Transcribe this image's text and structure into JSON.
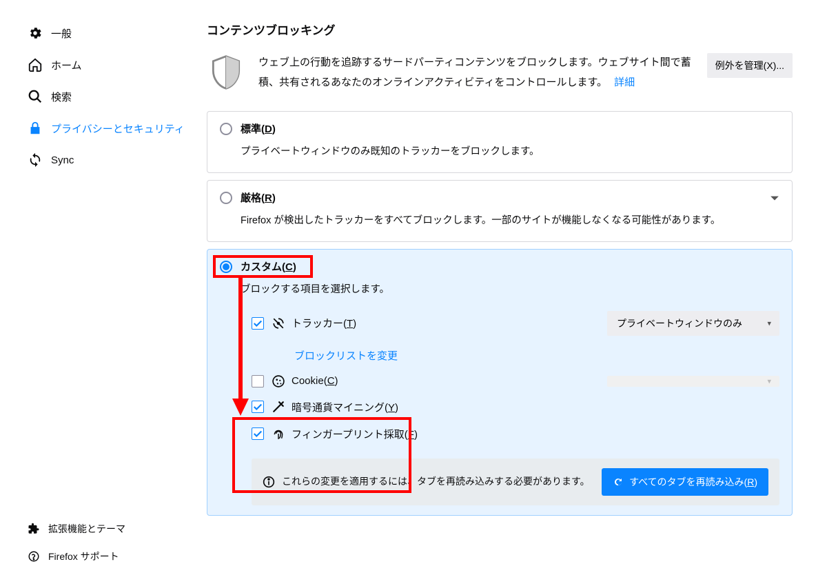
{
  "sidebar": {
    "items": [
      {
        "label": "一般"
      },
      {
        "label": "ホーム"
      },
      {
        "label": "検索"
      },
      {
        "label": "プライバシーとセキュリティ"
      },
      {
        "label": "Sync"
      }
    ],
    "bottom": [
      {
        "label": "拡張機能とテーマ"
      },
      {
        "label": "Firefox サポート"
      }
    ]
  },
  "section": {
    "title": "コンテンツブロッキング",
    "intro": "ウェブ上の行動を追跡するサードパーティコンテンツをブロックします。ウェブサイト間で蓄積、共有されるあなたのオンラインアクティビティをコントロールします。",
    "learn_more": "詳細",
    "exceptions_btn": "例外を管理(X)..."
  },
  "modes": {
    "standard": {
      "title_pre": "標準(",
      "hotkey": "D",
      "title_post": ")",
      "desc": "プライベートウィンドウのみ既知のトラッカーをブロックします。"
    },
    "strict": {
      "title_pre": "厳格(",
      "hotkey": "R",
      "title_post": ")",
      "desc": "Firefox が検出したトラッカーをすべてブロックします。一部のサイトが機能しなくなる可能性があります。"
    },
    "custom": {
      "title_pre": "カスタム(",
      "hotkey": "C",
      "title_post": ")",
      "desc": "ブロックする項目を選択します。"
    }
  },
  "options": {
    "trackers": {
      "label_pre": "トラッカー(",
      "hotkey": "T",
      "label_post": ")",
      "checked": true,
      "select": "プライベートウィンドウのみ"
    },
    "blocklist_link": "ブロックリストを変更",
    "cookies": {
      "label_pre": "Cookie(",
      "hotkey": "C",
      "label_post": ")",
      "checked": false,
      "select": ""
    },
    "cryptominers": {
      "label_pre": "暗号通貨マイニング(",
      "hotkey": "Y",
      "label_post": ")",
      "checked": true
    },
    "fingerprinters": {
      "label_pre": "フィンガープリント採取(",
      "hotkey": "F",
      "label_post": ")",
      "checked": true
    }
  },
  "reload": {
    "msg": "これらの変更を適用するには、タブを再読み込みする必要があります。",
    "btn_pre": "すべてのタブを再読み込み(",
    "btn_hotkey": "R",
    "btn_post": ")"
  }
}
